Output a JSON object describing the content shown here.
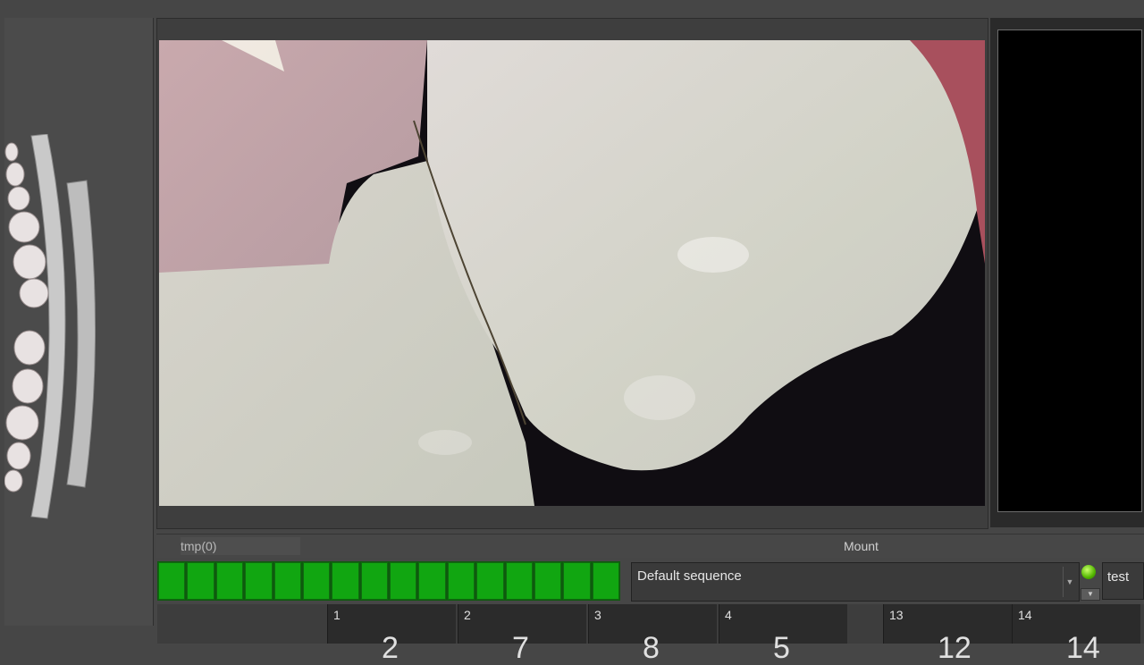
{
  "status_bar": {
    "tmp_label": "tmp(0)",
    "mount_label": "Mount"
  },
  "progress": {
    "segments": 16,
    "fill_fraction": 1.0,
    "color": "#11a611"
  },
  "sequence": {
    "selected": "Default sequence"
  },
  "status_led_color": "#52b500",
  "test_button": {
    "label": "test"
  },
  "slots": [
    {
      "number": "1",
      "value": "2"
    },
    {
      "number": "2",
      "value": "7"
    },
    {
      "number": "3",
      "value": "8"
    },
    {
      "number": "4",
      "value": "5"
    },
    {
      "number": "13",
      "value": "12"
    },
    {
      "number": "14",
      "value": "14"
    }
  ],
  "icons": {
    "tooth_chart": "dental-arch-icon",
    "dropdown": "chevron-down-icon"
  }
}
